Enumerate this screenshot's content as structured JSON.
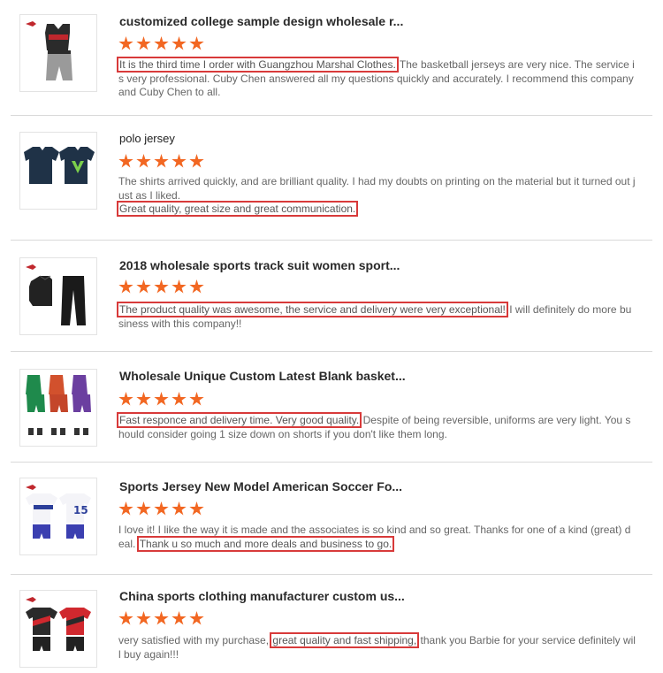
{
  "reviews": [
    {
      "title": "customized college sample design wholesale r...",
      "rating": 5,
      "highlight": "It is the third time I order with Guangzhou Marshal Clothes.",
      "after": " The basketball jerseys are very nice. The service is very professional. Cuby Chen answered all my questions quickly and accurately. I recommend this company and Cuby Chen to all.",
      "image": "basketball-jersey-icon"
    },
    {
      "title": "polo jersey",
      "rating": 5,
      "before": "The shirts arrived quickly, and are brilliant quality. I had my doubts on printing on the material but it turned out just as I liked.",
      "highlight": "Great quality, great size and great communication.",
      "image": "polo-jersey-icon"
    },
    {
      "title": "2018 wholesale sports track suit women sport...",
      "rating": 5,
      "highlight": "The product quality was awesome, the service and delivery were very exceptional!",
      "after": " I will definitely do more business with this company!!",
      "image": "tracksuit-icon"
    },
    {
      "title": "Wholesale Unique Custom Latest Blank basket...",
      "rating": 5,
      "highlight": "Fast responce and delivery time. Very good quality.",
      "after": " Despite of being reversible, uniforms are very light. You should consider going 1 size down on shorts if you don't like them long.",
      "image": "basketball-uniforms-icon"
    },
    {
      "title": "Sports Jersey New Model American Soccer Fo...",
      "rating": 5,
      "before": "I love it! I like the way it is made and the associates is so kind and so great. Thanks for one of a kind (great) deal.",
      "highlight": "Thank u so much and more deals and business to go.",
      "image": "soccer-jersey-icon"
    },
    {
      "title": "China sports clothing manufacturer custom us...",
      "rating": 5,
      "before": "very satisfied with my purchase,",
      "highlight": "great quality and fast shipping,",
      "after": " thank you Barbie for your service definitely will buy again!!!",
      "image": "sports-kit-icon"
    }
  ],
  "colors": {
    "star": "#f26722",
    "highlight_border": "#d83a3a"
  }
}
